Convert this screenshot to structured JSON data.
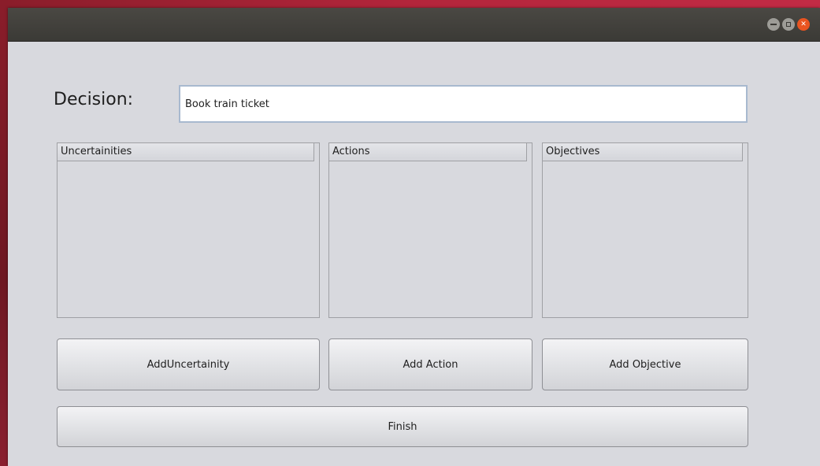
{
  "window": {
    "close_glyph": "✕"
  },
  "decision": {
    "label": "Decision:",
    "value": "Book train ticket"
  },
  "lists": {
    "uncertainties_header": "Uncertainities",
    "actions_header": "Actions",
    "objectives_header": "Objectives"
  },
  "buttons": {
    "add_uncertainty": "AddUncertainity",
    "add_action": "Add Action",
    "add_objective": "Add Objective",
    "finish": "Finish"
  },
  "colors": {
    "window_bg": "#d8d9de",
    "titlebar": "#3b3a36",
    "close_button": "#e95420",
    "input_border": "#a8b9cf"
  }
}
